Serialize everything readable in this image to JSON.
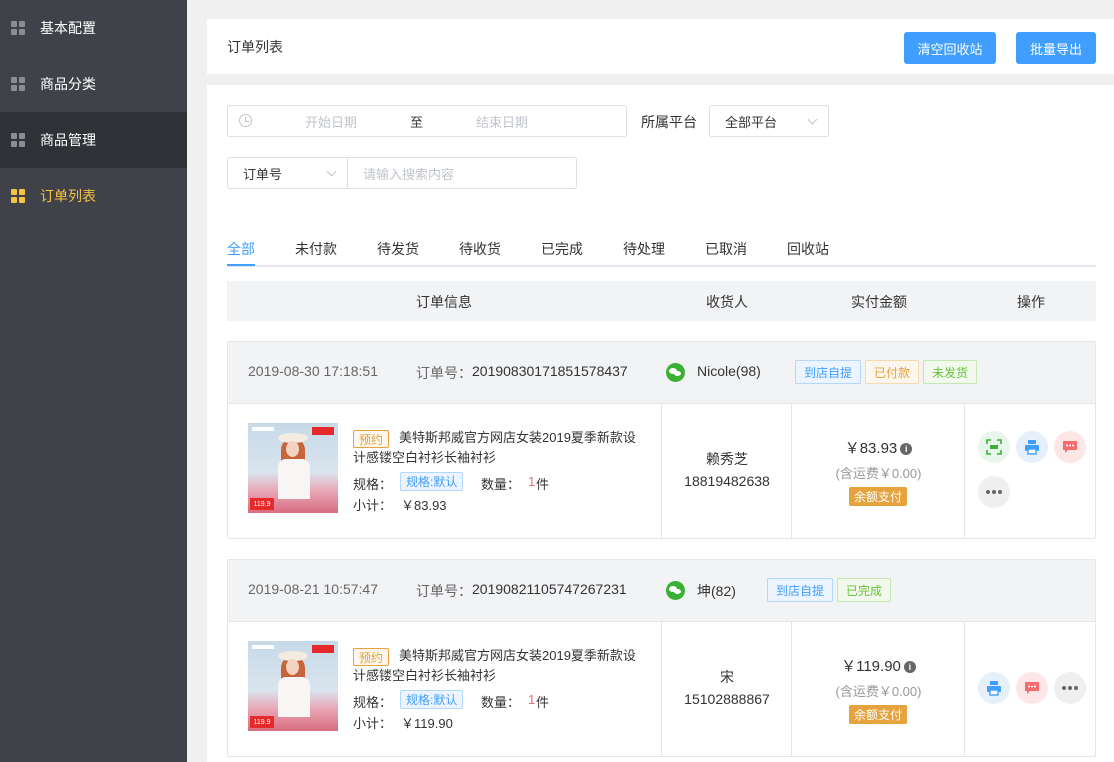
{
  "sidebar": {
    "items": [
      {
        "label": "基本配置"
      },
      {
        "label": "商品分类"
      },
      {
        "label": "商品管理"
      },
      {
        "label": "订单列表"
      }
    ]
  },
  "header": {
    "title": "订单列表",
    "clear_recycle_label": "清空回收站",
    "batch_export_label": "批量导出"
  },
  "filters": {
    "start_date_placeholder": "开始日期",
    "range_separator": "至",
    "end_date_placeholder": "结束日期",
    "platform_label": "所属平台",
    "platform_value": "全部平台",
    "search_field_value": "订单号",
    "search_placeholder": "请输入搜索内容"
  },
  "tabs": [
    {
      "label": "全部"
    },
    {
      "label": "未付款"
    },
    {
      "label": "待发货"
    },
    {
      "label": "待收货"
    },
    {
      "label": "已完成"
    },
    {
      "label": "待处理"
    },
    {
      "label": "已取消"
    },
    {
      "label": "回收站"
    }
  ],
  "table_header": {
    "info": "订单信息",
    "receiver": "收货人",
    "amount": "实付金额",
    "ops": "操作"
  },
  "labels": {
    "order_no": "订单号：",
    "spec": "规格：",
    "qty": "数量：",
    "qty_unit": "件",
    "subtotal": "小计："
  },
  "orders": [
    {
      "date": "2019-08-30 17:18:51",
      "order_no": "20190830171851578437",
      "user": "Nicole(98)",
      "tags": [
        "到店自提",
        "已付款",
        "未发货"
      ],
      "preorder": "预约",
      "product_name": "美特斯邦威官方网店女装2019夏季新款设计感镂空白衬衫长袖衬衫",
      "spec": "规格:默认",
      "qty": "1",
      "subtotal": "￥83.93",
      "receiver_name": "赖秀芝",
      "receiver_phone": "18819482638",
      "amount": "￥83.93",
      "shipping": "(含运费￥0.00)",
      "pay_method": "余额支付",
      "thumb_price": "119.9"
    },
    {
      "date": "2019-08-21 10:57:47",
      "order_no": "20190821105747267231",
      "user": "坤(82)",
      "tags": [
        "到店自提",
        "已完成"
      ],
      "preorder": "预约",
      "product_name": "美特斯邦威官方网店女装2019夏季新款设计感镂空白衬衫长袖衬衫",
      "spec": "规格:默认",
      "qty": "1",
      "subtotal": "￥119.90",
      "receiver_name": "宋",
      "receiver_phone": "15102888867",
      "amount": "￥119.90",
      "shipping": "(含运费￥0.00)",
      "pay_method": "余额支付",
      "thumb_price": "119.9"
    }
  ],
  "colors": {
    "sidebar_bg": "#3f4248",
    "sidebar_active": "#f5c242",
    "primary": "#409eff",
    "warning": "#e6a23c",
    "success": "#67c23a"
  }
}
